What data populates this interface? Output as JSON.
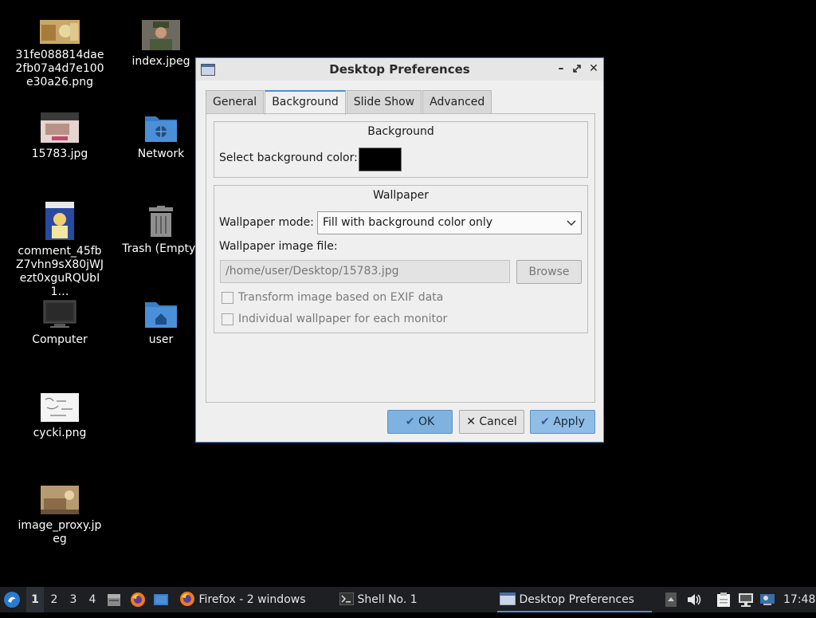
{
  "desktop": {
    "icons": [
      {
        "label": "31fe088814dae2fb07a4d7e100e30a26.png",
        "icon": "image-thumbnail-icon"
      },
      {
        "label": "index.jpeg",
        "icon": "image-thumbnail-icon"
      },
      {
        "label": "15783.jpg",
        "icon": "image-thumbnail-icon"
      },
      {
        "label": "Network",
        "icon": "network-folder-icon"
      },
      {
        "label": "comment_45fbZ7vhn9sX80jWJezt0xguRQUbI1…",
        "icon": "image-thumbnail-icon"
      },
      {
        "label": "Trash (Empty)",
        "icon": "trash-icon"
      },
      {
        "label": "Computer",
        "icon": "computer-icon"
      },
      {
        "label": "user",
        "icon": "home-folder-icon"
      },
      {
        "label": "cycki.png",
        "icon": "image-thumbnail-icon"
      },
      {
        "label": "image_proxy.jpeg",
        "icon": "image-thumbnail-icon"
      }
    ]
  },
  "dialog": {
    "title": "Desktop Preferences",
    "tabs": [
      {
        "label": "General"
      },
      {
        "label": "Background"
      },
      {
        "label": "Slide Show"
      },
      {
        "label": "Advanced"
      }
    ],
    "active_tab": "Background",
    "background_group": {
      "title": "Background",
      "color_label": "Select background color:",
      "color_value": "#000000"
    },
    "wallpaper_group": {
      "title": "Wallpaper",
      "mode_label": "Wallpaper mode:",
      "mode_value": "Fill with background color only",
      "file_label": "Wallpaper image file:",
      "file_value": "/home/user/Desktop/15783.jpg",
      "browse_label": "Browse",
      "exif_label": "Transform image based on EXIF data",
      "individual_label": "Individual wallpaper for each monitor"
    },
    "buttons": {
      "ok": "OK",
      "cancel": "Cancel",
      "apply": "Apply"
    }
  },
  "taskbar": {
    "workspaces": [
      "1",
      "2",
      "3",
      "4"
    ],
    "active_workspace": "1",
    "tasks": [
      {
        "label": "Firefox - 2 windows",
        "icon": "firefox-icon"
      },
      {
        "label": "Shell No. 1",
        "icon": "terminal-icon"
      },
      {
        "label": "Desktop Preferences",
        "icon": "window-icon"
      }
    ],
    "clock": "17:48"
  },
  "colors": {
    "desktop_bg": "#000000",
    "accent": "#4a90d9",
    "taskbar_bg": "#1d1f22"
  }
}
